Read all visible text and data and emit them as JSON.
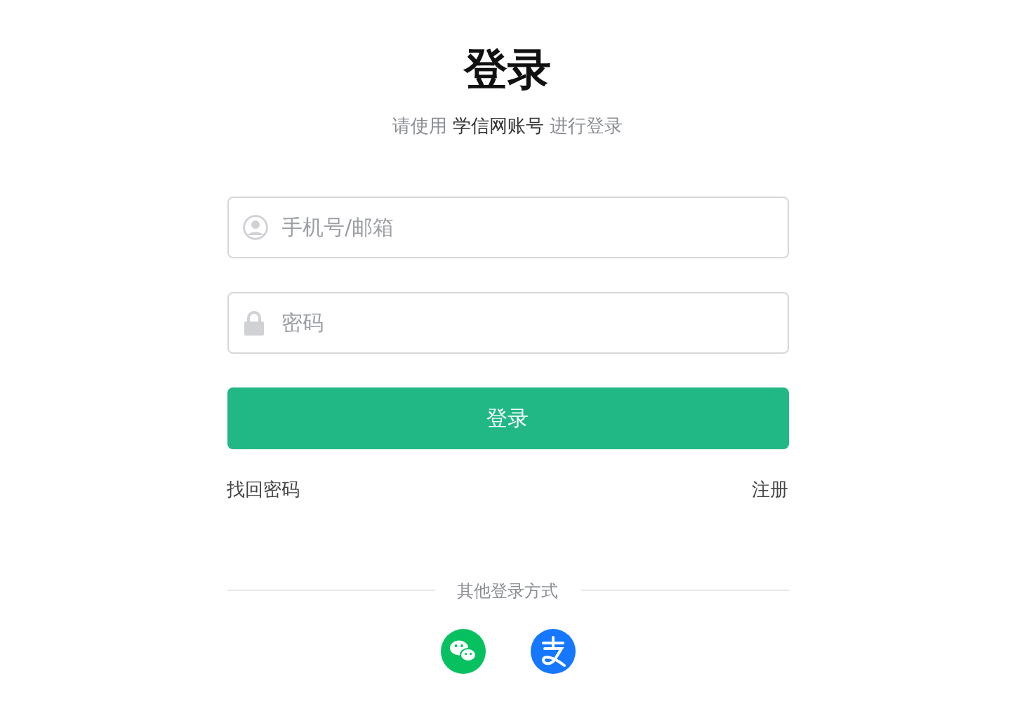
{
  "title": "登录",
  "subtitle": "请使用 **学信网账号** 进行登录",
  "fields": [
    {
      "kind": "user",
      "placeholder": "手机号/邮箱"
    },
    {
      "kind": "password",
      "placeholder": "密码"
    }
  ],
  "submit": "登录",
  "links": [
    "找回密码",
    "注册"
  ],
  "other_login": {
    "label": "其他登录方式",
    "methods": [
      {
        "kind": "wechat",
        "color": "#07c160"
      },
      {
        "kind": "alipay",
        "color": "#1677ff"
      }
    ]
  }
}
